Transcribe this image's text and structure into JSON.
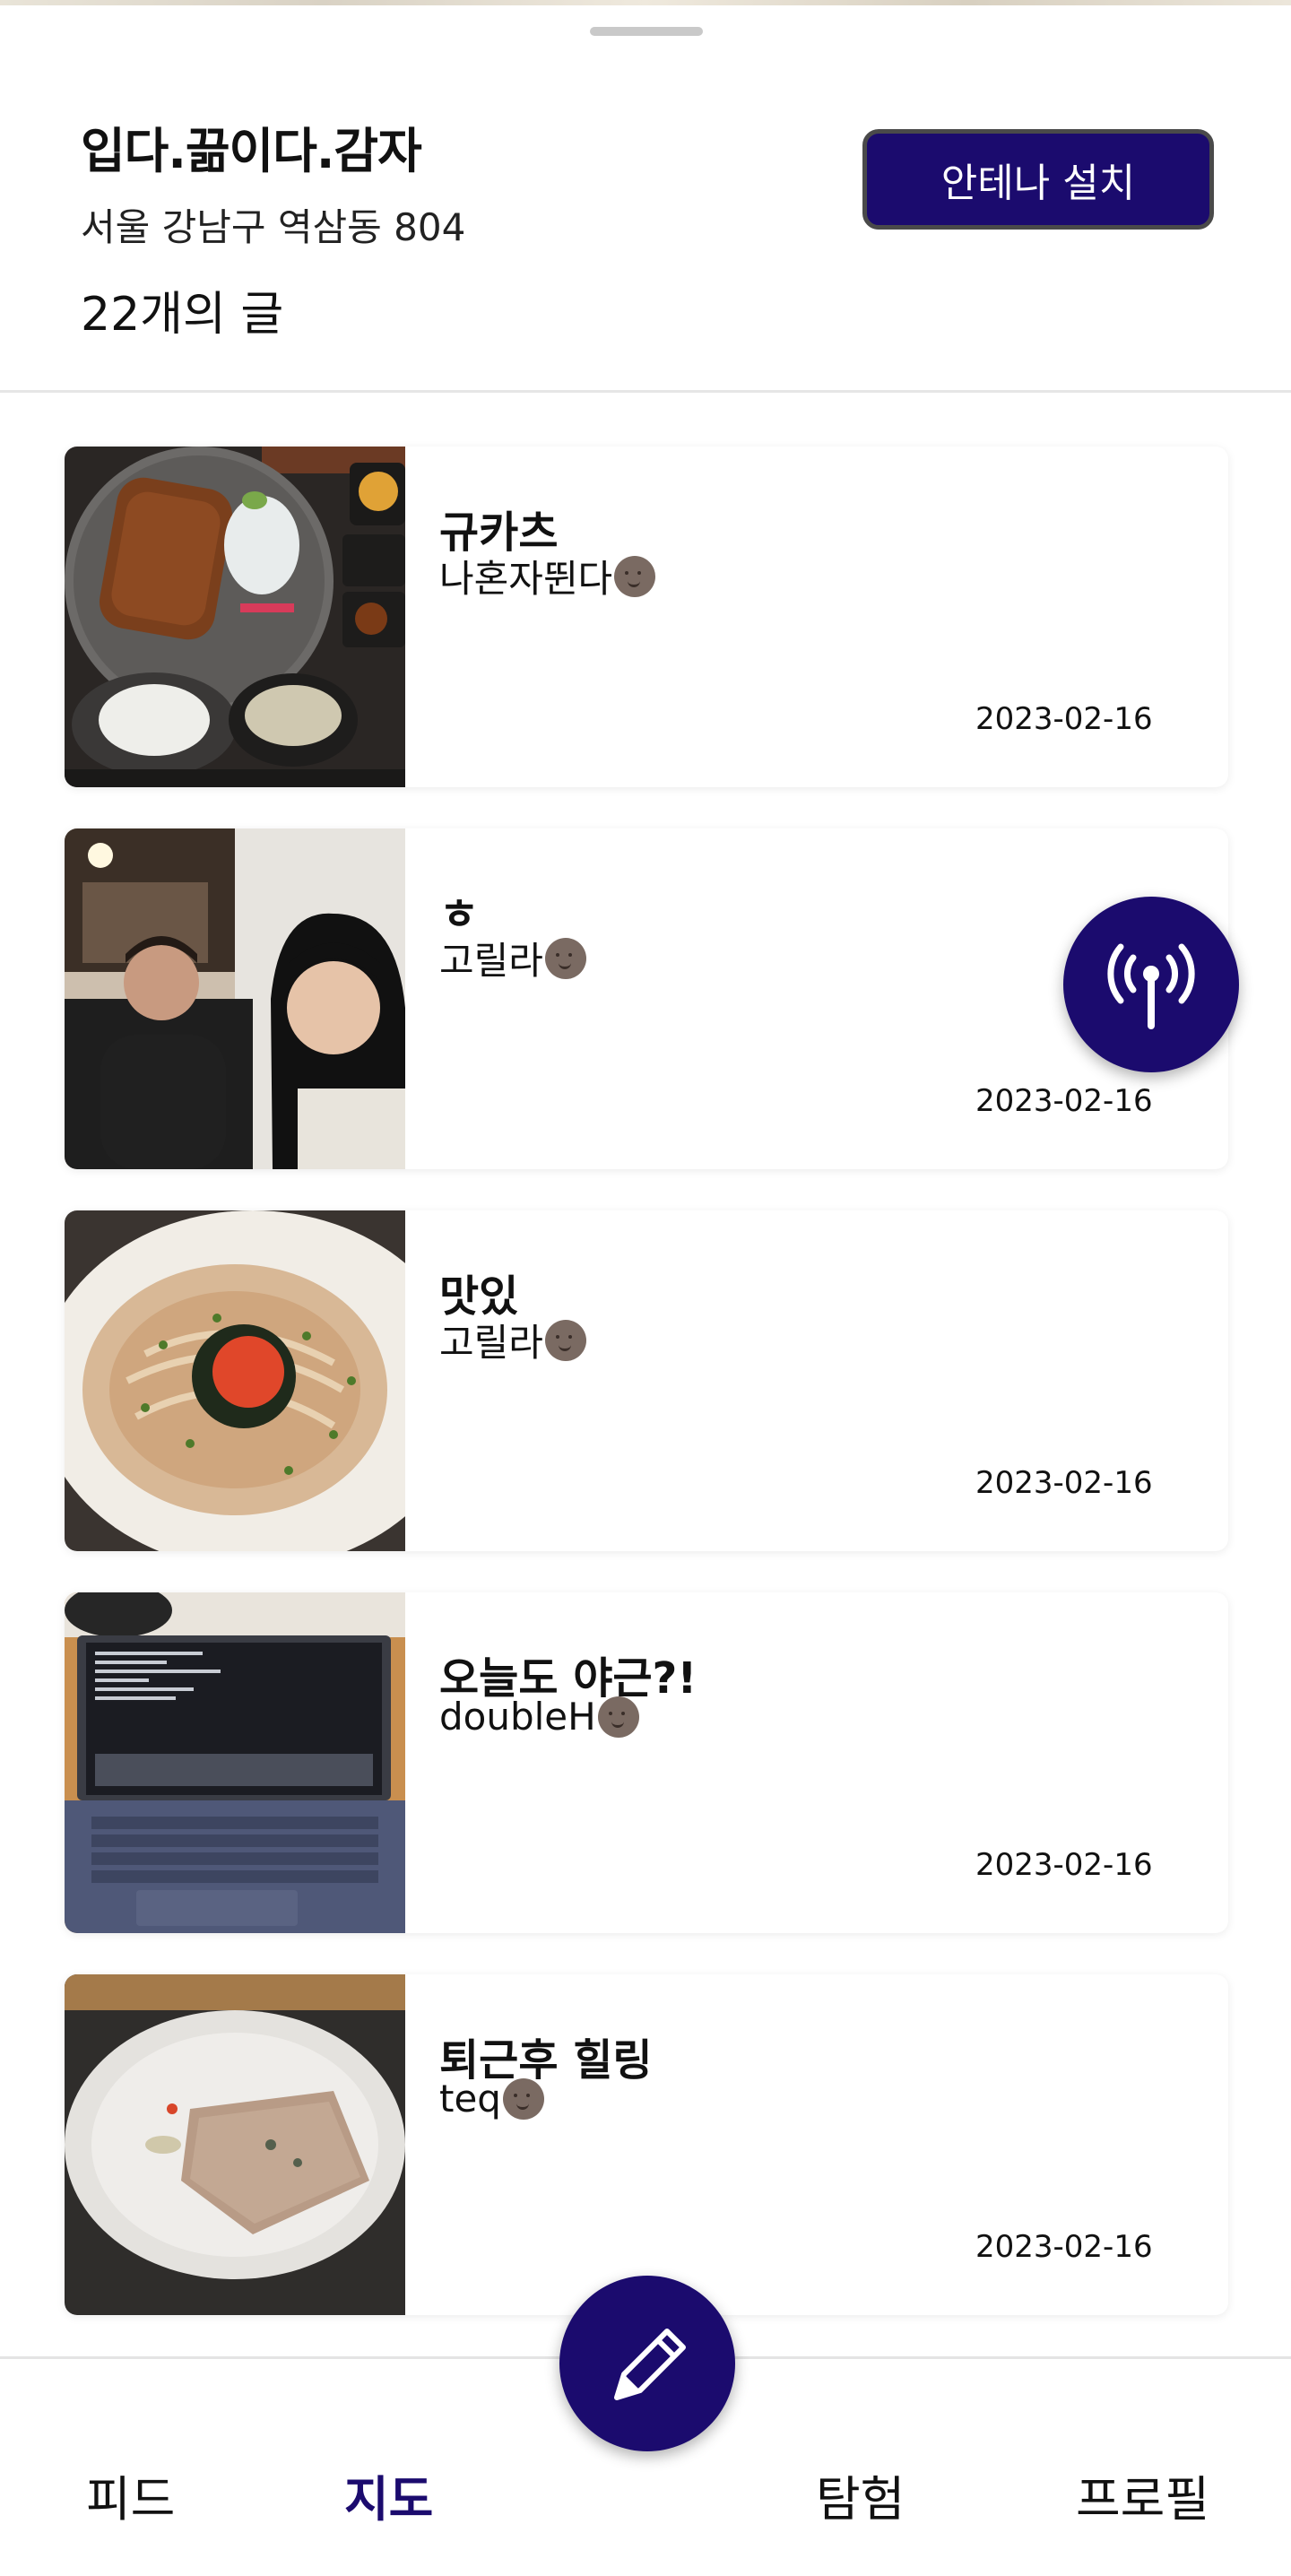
{
  "sheet": {
    "place_name": "입다.끎이다.감자",
    "address": "서울 강남구 역삼동 804",
    "post_count": "22개의 글",
    "install_button": "안테나 설치"
  },
  "posts": [
    {
      "title": "규카츠",
      "author": "나혼자뛴다",
      "date": "2023-02-16",
      "photo": "katsu-set"
    },
    {
      "title": "ㅎ",
      "author": "고릴라",
      "date": "2023-02-16",
      "photo": "selfie-two-people"
    },
    {
      "title": "맛있",
      "author": "고릴라",
      "date": "2023-02-16",
      "photo": "cream-pasta"
    },
    {
      "title": "오늘도 야근?!",
      "author": "doubleH",
      "date": "2023-02-16",
      "photo": "laptop"
    },
    {
      "title": "퇴근후 힐링",
      "author": "teq",
      "date": "2023-02-16",
      "photo": "crepe-plate"
    }
  ],
  "nav": {
    "feed": "피드",
    "map": "지도",
    "explore": "탐험",
    "profile": "프로필"
  },
  "fab": {
    "antenna_icon": "antenna-icon",
    "write_icon": "pencil-icon"
  },
  "colors": {
    "accent": "#1b0b6e",
    "avatar": "#7a6a62"
  }
}
